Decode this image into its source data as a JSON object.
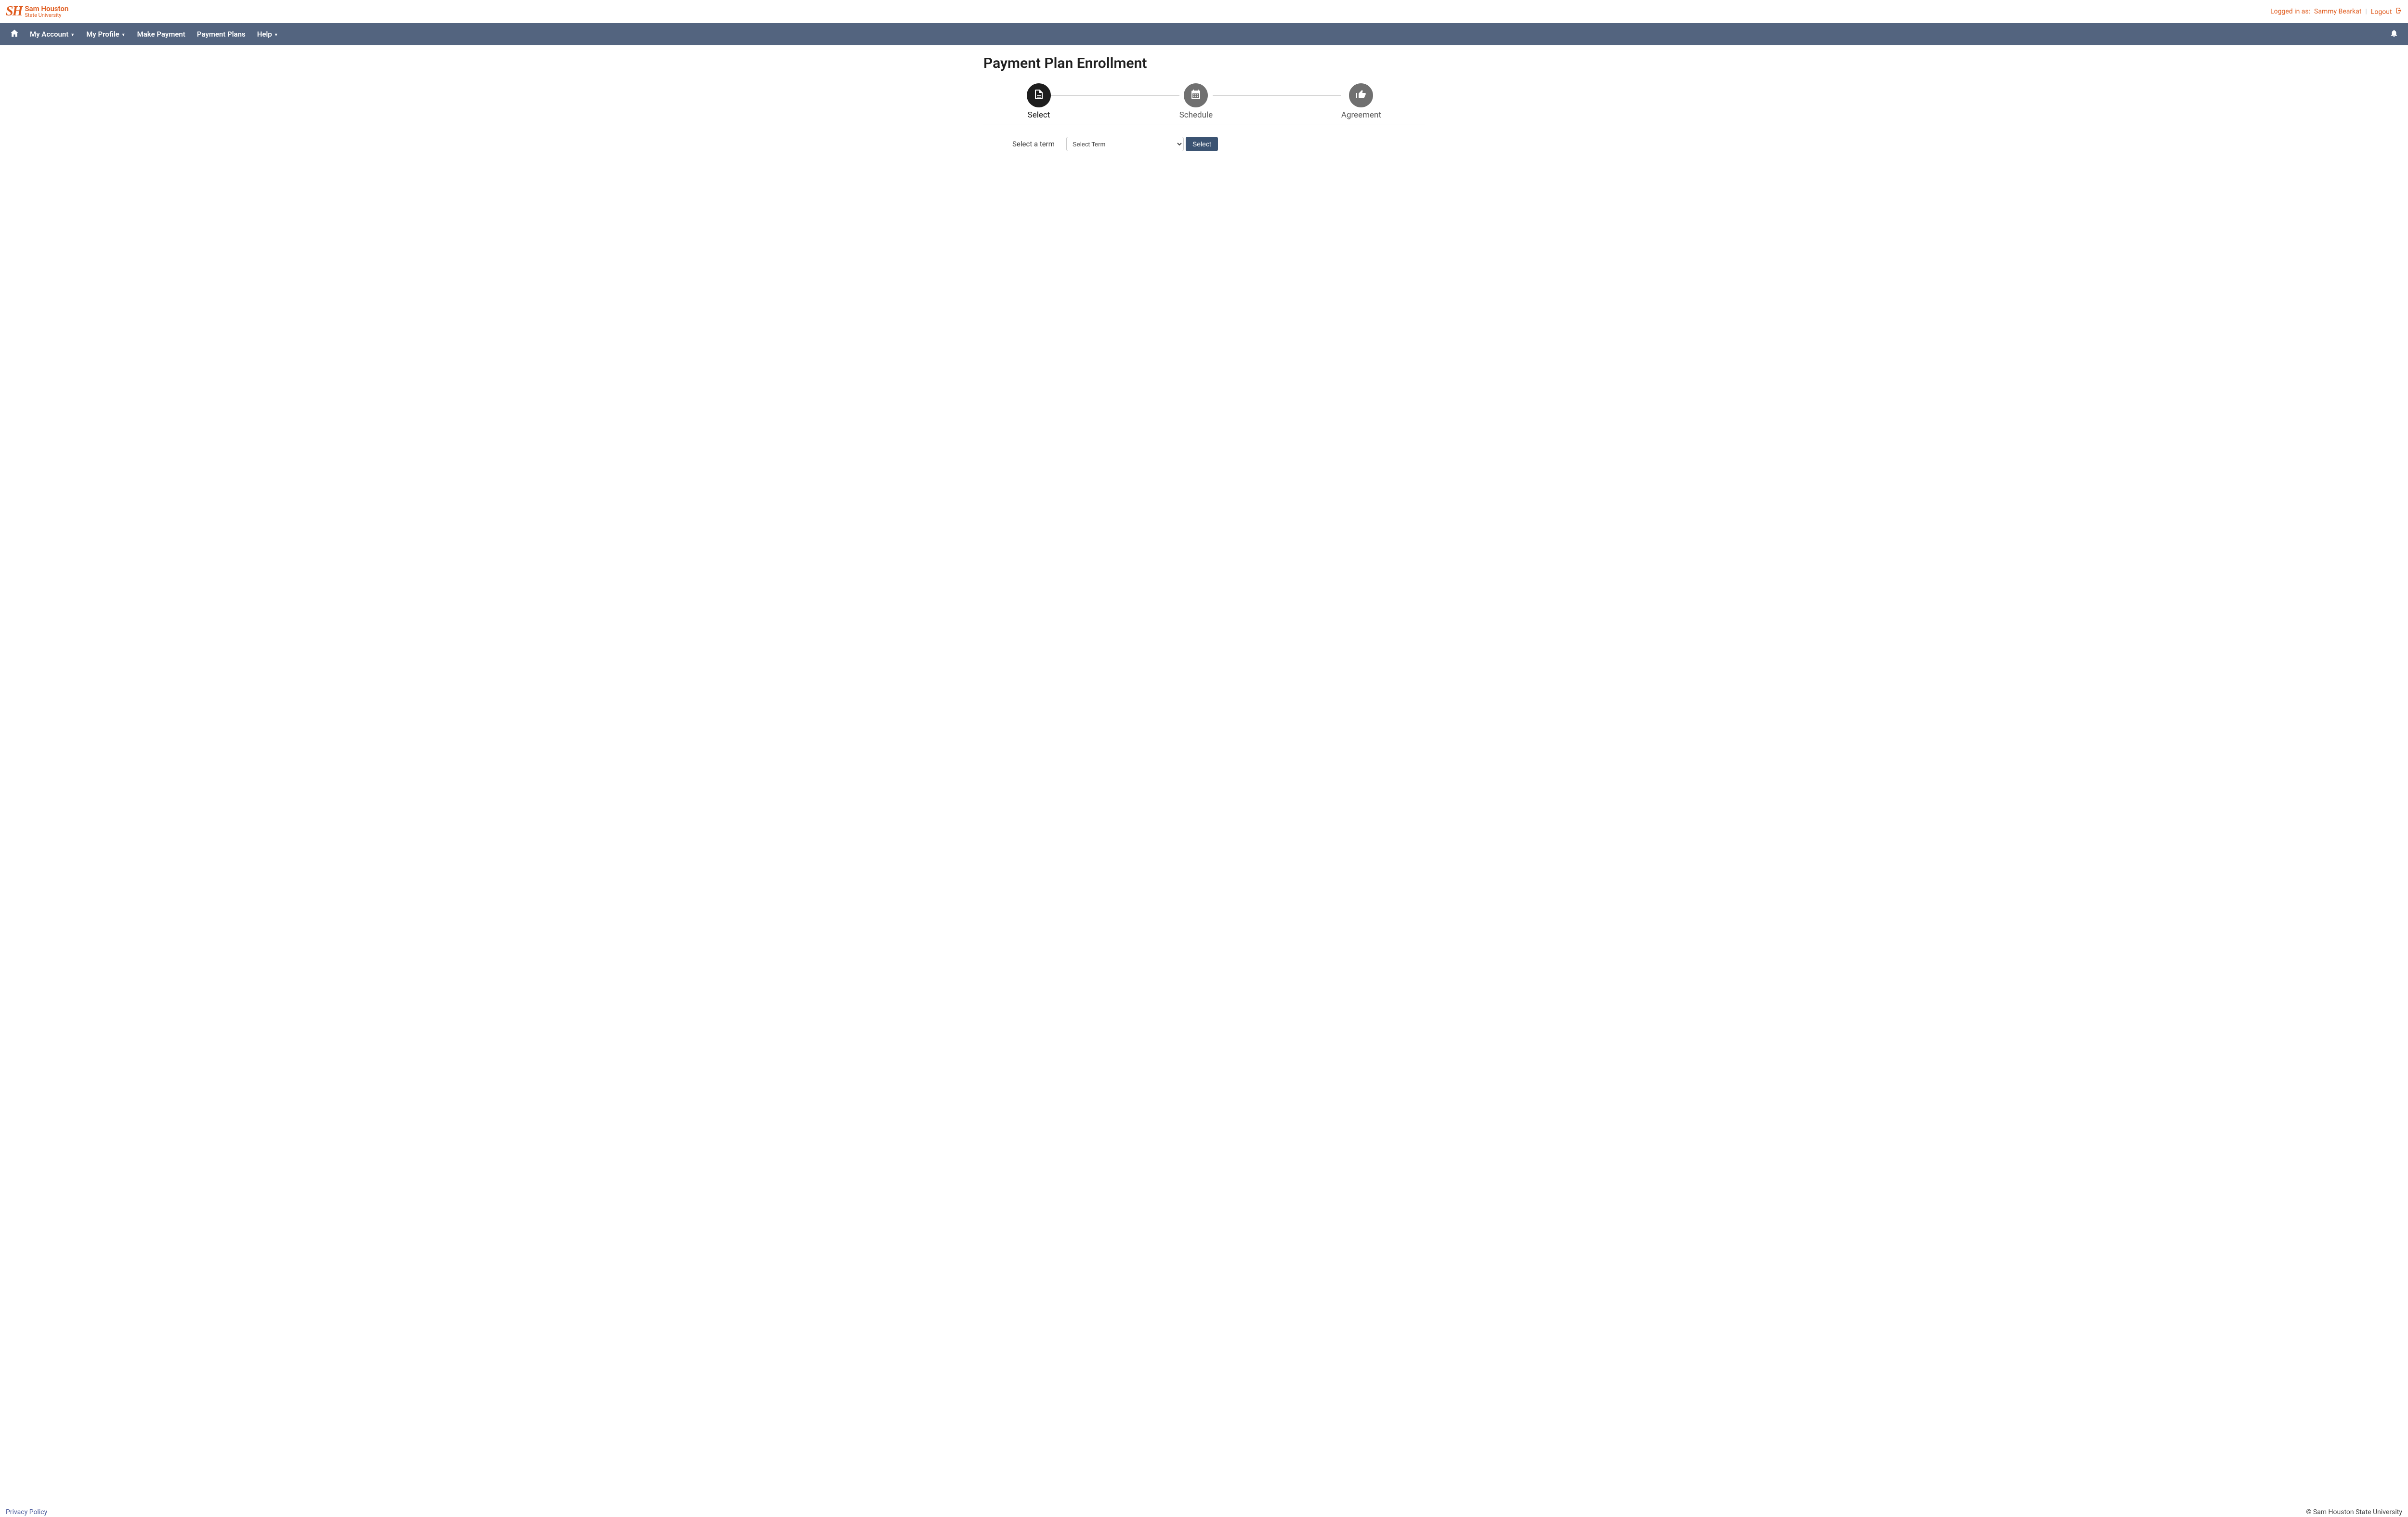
{
  "header": {
    "logo_initials": "SH",
    "logo_name": "Sam Houston",
    "logo_sub": "State University",
    "logged_in_label": "Logged in as:",
    "user_name": "Sammy Bearkat",
    "logout_label": "Logout"
  },
  "nav": {
    "items": [
      {
        "label": "My Account",
        "has_caret": true
      },
      {
        "label": "My Profile",
        "has_caret": true
      },
      {
        "label": "Make Payment",
        "has_caret": false
      },
      {
        "label": "Payment Plans",
        "has_caret": false
      },
      {
        "label": "Help",
        "has_caret": true
      }
    ]
  },
  "page": {
    "title": "Payment Plan Enrollment"
  },
  "stepper": {
    "steps": [
      {
        "label": "Select",
        "active": true,
        "icon": "document"
      },
      {
        "label": "Schedule",
        "active": false,
        "icon": "calendar"
      },
      {
        "label": "Agreement",
        "active": false,
        "icon": "thumbs-up"
      }
    ]
  },
  "form": {
    "term_label": "Select a term",
    "term_placeholder": "Select Term",
    "select_button": "Select"
  },
  "footer": {
    "privacy": "Privacy Policy",
    "copyright": "© Sam Houston State University"
  }
}
